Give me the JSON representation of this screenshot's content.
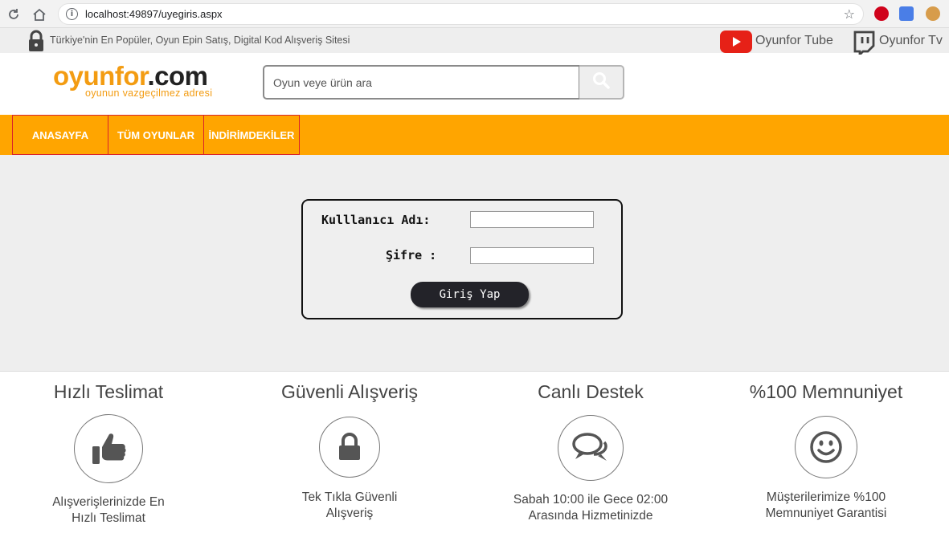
{
  "browser": {
    "url": "localhost:49897/uyegiris.aspx"
  },
  "topbar": {
    "tagline": "Türkiye'nin En Popüler, Oyun Epin Satış, Digital Kod Alışveriş Sitesi",
    "tube_label": "Oyunfor Tube",
    "tv_label": "Oyunfor Tv"
  },
  "header": {
    "logo_part1": "oyunfor",
    "logo_part2": ".com",
    "slogan": "oyunun vazgeçilmez adresi",
    "search_placeholder": "Oyun veye ürün ara"
  },
  "nav": {
    "items": [
      "ANASAYFA",
      "TÜM OYUNLAR",
      "İNDİRİMDEKİLER"
    ]
  },
  "login": {
    "username_label": "Kulllanıcı Adı:",
    "password_label": "Şifre :",
    "username_value": "",
    "password_value": "",
    "submit_label": "Giriş Yap"
  },
  "features": [
    {
      "title": "Hızlı Teslimat",
      "icon": "thumbs-up-icon",
      "line1": "Alışverişlerinizde En",
      "line2": "Hızlı Teslimat"
    },
    {
      "title": "Güvenli Alışveriş",
      "icon": "lock-icon",
      "line1": "Tek Tıkla Güvenli",
      "line2": "Alışveriş"
    },
    {
      "title": "Canlı Destek",
      "icon": "chat-icon",
      "line1": "Sabah 10:00 ile Gece 02:00",
      "line2": "Arasında Hizmetinizde"
    },
    {
      "title": "%100 Memnuniyet",
      "icon": "smile-icon",
      "line1": "Müşterilerimize %100",
      "line2": "Memnuniyet Garantisi"
    }
  ],
  "colors": {
    "brand_orange": "#ffa500",
    "nav_border": "#d9232a",
    "button_dark": "#232329"
  }
}
